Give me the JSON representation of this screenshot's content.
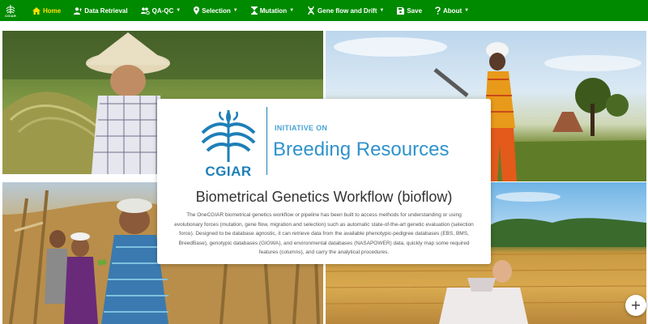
{
  "brand": {
    "logo_text": "CGIAR"
  },
  "nav": {
    "items": [
      {
        "label": "Home",
        "icon": "home-icon",
        "active": true,
        "dropdown": false
      },
      {
        "label": "Data Retrieval",
        "icon": "user-upload-icon",
        "active": false,
        "dropdown": false
      },
      {
        "label": "QA-QC",
        "icon": "users-cog-icon",
        "active": false,
        "dropdown": true
      },
      {
        "label": "Selection",
        "icon": "map-pin-icon",
        "active": false,
        "dropdown": true
      },
      {
        "label": "Mutation",
        "icon": "hourglass-icon",
        "active": false,
        "dropdown": true
      },
      {
        "label": "Gene flow and Drift",
        "icon": "dna-icon",
        "active": false,
        "dropdown": true
      },
      {
        "label": "Save",
        "icon": "save-icon",
        "active": false,
        "dropdown": false
      },
      {
        "label": "About",
        "icon": "question-icon",
        "active": false,
        "dropdown": true
      }
    ],
    "active_color": "#ffe100",
    "bar_color": "#008a00"
  },
  "card": {
    "logo_word": "CGIAR",
    "initiative_label": "INITIATIVE ON",
    "initiative_name": "Breeding Resources",
    "title": "Biometrical Genetics Workflow (bioflow)",
    "description": "The OneCGIAR biometrical genetics workflow or pipeline has been built to access methods for understanding or using evolutionary forces (mutation, gene flow, migration and selection) such as automatic state-of-the-art genetic evaluation (selection force).  Designed to be database agnostic, it can retrieve data from the available phenotypic-pedigree databases (EBS, BMS, BreedBase), genotypic databases (GIGWA), and environmental databases (NASAPOWER) data, quickly map some required features (columns), and carry the analytical procedures."
  },
  "fab": {
    "label": "+"
  }
}
